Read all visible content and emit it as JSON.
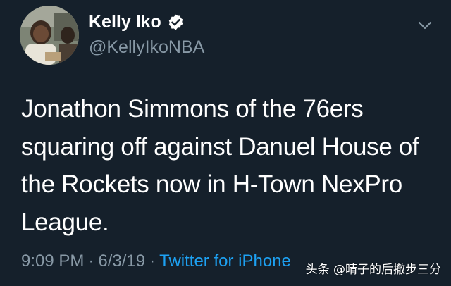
{
  "author": {
    "display_name": "Kelly Iko",
    "handle": "@KellyIkoNBA",
    "verified": true,
    "avatar_icon": "profile-photo"
  },
  "menu": {
    "icon": "chevron-down-icon"
  },
  "tweet": {
    "text_lines": [
      "Jonathon Simmons of the 76ers",
      "squaring off against Danuel House of",
      "the Rockets now in H-Town NexPro",
      "League."
    ],
    "time": "9:09 PM",
    "date": "6/3/19",
    "separator": "·",
    "source": "Twitter for iPhone"
  },
  "watermark": {
    "text": "头条 @晴子的后撤步三分"
  },
  "colors": {
    "background": "#15202b",
    "text_primary": "#ffffff",
    "text_secondary": "#8899a6",
    "accent": "#1da1f2"
  }
}
